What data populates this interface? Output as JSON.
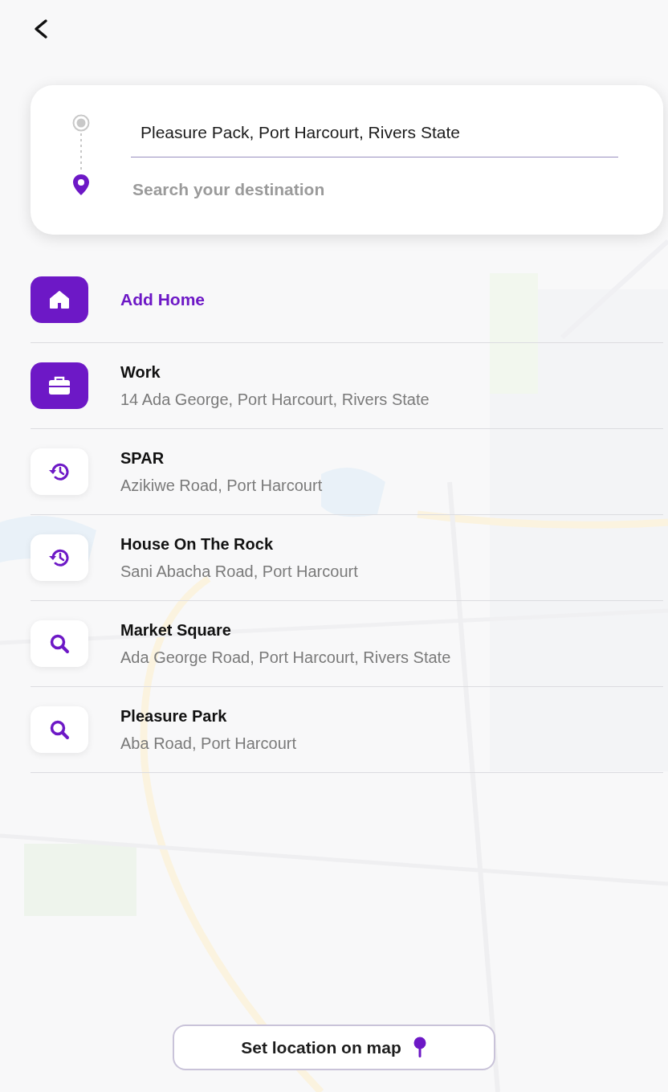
{
  "route": {
    "origin": {
      "value": "Pleasure Pack, Port Harcourt, Rivers State"
    },
    "destination": {
      "placeholder": "Search your destination"
    }
  },
  "places": [
    {
      "kind": "home",
      "title": "Add Home"
    },
    {
      "kind": "work",
      "title": "Work",
      "address": "14 Ada George, Port Harcourt, Rivers State"
    },
    {
      "kind": "recent",
      "title": "SPAR",
      "address": "Azikiwe Road, Port Harcourt"
    },
    {
      "kind": "recent",
      "title": "House On The Rock",
      "address": "Sani Abacha Road, Port Harcourt"
    },
    {
      "kind": "search",
      "title": "Market Square",
      "address": "Ada George Road, Port Harcourt, Rivers State"
    },
    {
      "kind": "search",
      "title": "Pleasure Park",
      "address": "Aba Road, Port Harcourt"
    }
  ],
  "map_button": {
    "label": "Set location on map"
  }
}
